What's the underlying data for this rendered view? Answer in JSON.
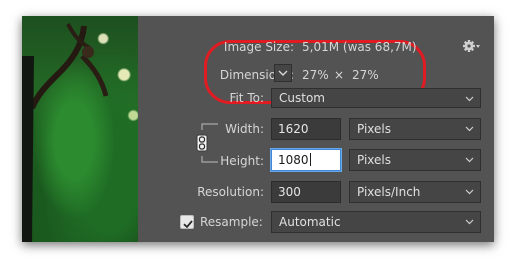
{
  "image_size": {
    "label": "Image Size:",
    "value": "5,01M (was 68,7M)"
  },
  "dimensions": {
    "label": "Dimensions:",
    "width_value": "27%",
    "times": "×",
    "height_value": "27%"
  },
  "fit_to": {
    "label": "Fit To:",
    "value": "Custom"
  },
  "width": {
    "label": "Width:",
    "value": "1620",
    "unit": "Pixels"
  },
  "height": {
    "label": "Height:",
    "value": "1080",
    "unit": "Pixels"
  },
  "resolution": {
    "label": "Resolution:",
    "value": "300",
    "unit": "Pixels/Inch"
  },
  "resample": {
    "label": "Resample:",
    "checked": true,
    "value": "Automatic"
  },
  "icons": {
    "settings": "gear-icon",
    "link": "chain-link-icon",
    "dimensions_toggle": "chevron-down-icon"
  },
  "colors": {
    "panel_bg": "#535353",
    "highlight_oval": "#e11b22",
    "active_field_border": "#3d87d8"
  }
}
